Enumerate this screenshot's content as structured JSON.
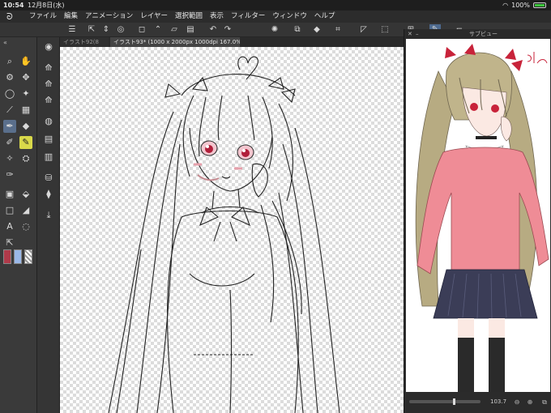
{
  "status": {
    "time": "10:54",
    "date": "12月8日(水)",
    "battery": "100%"
  },
  "menu": {
    "items": [
      "ファイル",
      "編集",
      "アニメーション",
      "レイヤー",
      "選択範囲",
      "表示",
      "フィルター",
      "ウィンドウ",
      "ヘルプ"
    ]
  },
  "tabs": {
    "inactive": "イラスト92(8",
    "active": "イラスト93* (1000 x 2000px 1000dpi 167.0%)"
  },
  "subview": {
    "title": "サブビュー",
    "zoom": "103.7",
    "rotation": "0.0"
  },
  "colors": {
    "main_color": "#b03a4a",
    "sub_color": "#9ab8e8",
    "accent": "#5a6f8c"
  }
}
